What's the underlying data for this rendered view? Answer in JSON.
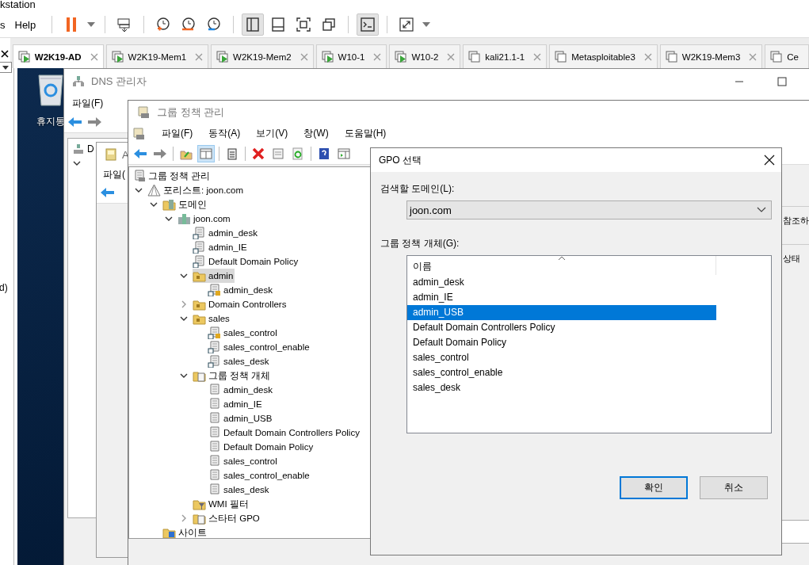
{
  "app": {
    "title": "kstation",
    "menu": [
      "s",
      "Help"
    ]
  },
  "toolbar": [
    [
      {
        "kind": "pause",
        "pressed": false
      },
      {
        "kind": "caret",
        "pressed": false
      }
    ],
    [
      {
        "kind": "send-keys",
        "pressed": false
      }
    ],
    [
      {
        "kind": "snapshot-take",
        "pressed": false
      },
      {
        "kind": "snapshot-revert",
        "pressed": false
      },
      {
        "kind": "snapshot-manage",
        "pressed": false
      }
    ],
    [
      {
        "kind": "view-sidebar",
        "pressed": true
      },
      {
        "kind": "view-thumbs",
        "pressed": false
      },
      {
        "kind": "view-full",
        "pressed": false
      },
      {
        "kind": "view-unity",
        "pressed": false
      }
    ],
    [
      {
        "kind": "console",
        "pressed": true
      }
    ],
    [
      {
        "kind": "stretch",
        "pressed": false
      },
      {
        "kind": "caret",
        "pressed": false
      }
    ]
  ],
  "tabs": [
    {
      "label": "W2K19-AD",
      "selected": true,
      "running": true
    },
    {
      "label": "W2K19-Mem1",
      "selected": false,
      "running": true
    },
    {
      "label": "W2K19-Mem2",
      "selected": false,
      "running": true
    },
    {
      "label": "W10-1",
      "selected": false,
      "running": true
    },
    {
      "label": "W10-2",
      "selected": false,
      "running": true
    },
    {
      "label": "kali21.1-1",
      "selected": false,
      "running": false
    },
    {
      "label": "Metasploitable3",
      "selected": false,
      "running": false
    },
    {
      "label": "W2K19-Mem3",
      "selected": false,
      "running": false
    },
    {
      "label": "Ce",
      "selected": false,
      "running": false
    }
  ],
  "library": {
    "text": "d)"
  },
  "desktop": {
    "icons": [
      {
        "label": "휴지통"
      }
    ]
  },
  "dns_window": {
    "title": "DNS 관리자",
    "menu": [
      "파일(F)"
    ],
    "tree": [
      {
        "label": "D"
      }
    ]
  },
  "ad_window": {
    "title": "A",
    "menu": [
      "파일("
    ]
  },
  "gpm_window": {
    "title": "그룹 정책 관리",
    "menu": [
      "파일(F)",
      "동작(A)",
      "보기(V)",
      "창(W)",
      "도움말(H)"
    ],
    "toolbar": [
      {
        "kind": "back",
        "pressed": false
      },
      {
        "kind": "forward",
        "pressed": false
      },
      {
        "kind": "up",
        "pressed": false
      },
      {
        "kind": "pane",
        "pressed": true
      },
      {
        "kind": "clipboard",
        "pressed": false
      },
      {
        "kind": "delete",
        "pressed": false
      },
      {
        "kind": "properties",
        "pressed": false
      },
      {
        "kind": "refresh",
        "pressed": false
      },
      {
        "kind": "help",
        "pressed": false
      },
      {
        "kind": "action-pane",
        "pressed": false
      }
    ],
    "tree": [
      {
        "label": "그룹 정책 관리",
        "kind": "root",
        "selected": false,
        "children": [
          {
            "label": "포리스트: joon.com",
            "kind": "forest",
            "expanded": true,
            "selected": false,
            "children": [
              {
                "label": "도메인",
                "kind": "domains",
                "expanded": true,
                "selected": false,
                "children": [
                  {
                    "label": "joon.com",
                    "kind": "domain",
                    "expanded": true,
                    "selected": false,
                    "children": [
                      {
                        "label": "admin_desk",
                        "kind": "link",
                        "selected": false
                      },
                      {
                        "label": "admin_IE",
                        "kind": "link",
                        "selected": false
                      },
                      {
                        "label": "Default Domain Policy",
                        "kind": "link",
                        "selected": false
                      },
                      {
                        "label": "admin",
                        "kind": "ou",
                        "expanded": true,
                        "selected": true,
                        "children": [
                          {
                            "label": "admin_desk",
                            "kind": "link-locked",
                            "selected": false
                          }
                        ]
                      },
                      {
                        "label": "Domain Controllers",
                        "kind": "ou",
                        "expanded": false,
                        "selected": false
                      },
                      {
                        "label": "sales",
                        "kind": "ou",
                        "expanded": true,
                        "selected": false,
                        "children": [
                          {
                            "label": "sales_control",
                            "kind": "link-locked",
                            "selected": false
                          },
                          {
                            "label": "sales_control_enable",
                            "kind": "link",
                            "selected": false
                          },
                          {
                            "label": "sales_desk",
                            "kind": "link",
                            "selected": false
                          }
                        ]
                      },
                      {
                        "label": "그룹 정책 개체",
                        "kind": "gpo-folder",
                        "expanded": true,
                        "selected": false,
                        "children": [
                          {
                            "label": "admin_desk",
                            "kind": "gpo",
                            "selected": false
                          },
                          {
                            "label": "admin_IE",
                            "kind": "gpo",
                            "selected": false
                          },
                          {
                            "label": "admin_USB",
                            "kind": "gpo",
                            "selected": false
                          },
                          {
                            "label": "Default Domain Controllers Policy",
                            "kind": "gpo",
                            "selected": false
                          },
                          {
                            "label": "Default Domain Policy",
                            "kind": "gpo",
                            "selected": false
                          },
                          {
                            "label": "sales_control",
                            "kind": "gpo",
                            "selected": false
                          },
                          {
                            "label": "sales_control_enable",
                            "kind": "gpo",
                            "selected": false
                          },
                          {
                            "label": "sales_desk",
                            "kind": "gpo",
                            "selected": false
                          }
                        ]
                      },
                      {
                        "label": "WMI 필터",
                        "kind": "filter",
                        "selected": false
                      },
                      {
                        "label": "스타터 GPO",
                        "kind": "starter",
                        "expanded": false,
                        "selected": false
                      }
                    ]
                  }
                ]
              },
              {
                "label": "사이트",
                "kind": "sites",
                "selected": false
              }
            ]
          }
        ]
      }
    ],
    "right_pane": [
      "참조하",
      "상태"
    ]
  },
  "dialog": {
    "title": "GPO 선택",
    "domain_label": "검색할 도메인(L):",
    "domain_value": "joon.com",
    "gpo_label": "그룹 정책 개체(G):",
    "list": {
      "column": "이름",
      "items": [
        {
          "label": "admin_desk",
          "selected": false
        },
        {
          "label": "admin_IE",
          "selected": false
        },
        {
          "label": "admin_USB",
          "selected": true
        },
        {
          "label": "Default Domain Controllers Policy",
          "selected": false
        },
        {
          "label": "Default Domain Policy",
          "selected": false
        },
        {
          "label": "sales_control",
          "selected": false
        },
        {
          "label": "sales_control_enable",
          "selected": false
        },
        {
          "label": "sales_desk",
          "selected": false
        }
      ]
    },
    "buttons": [
      {
        "label": "확인",
        "default": true
      },
      {
        "label": "취소",
        "default": false
      }
    ]
  }
}
